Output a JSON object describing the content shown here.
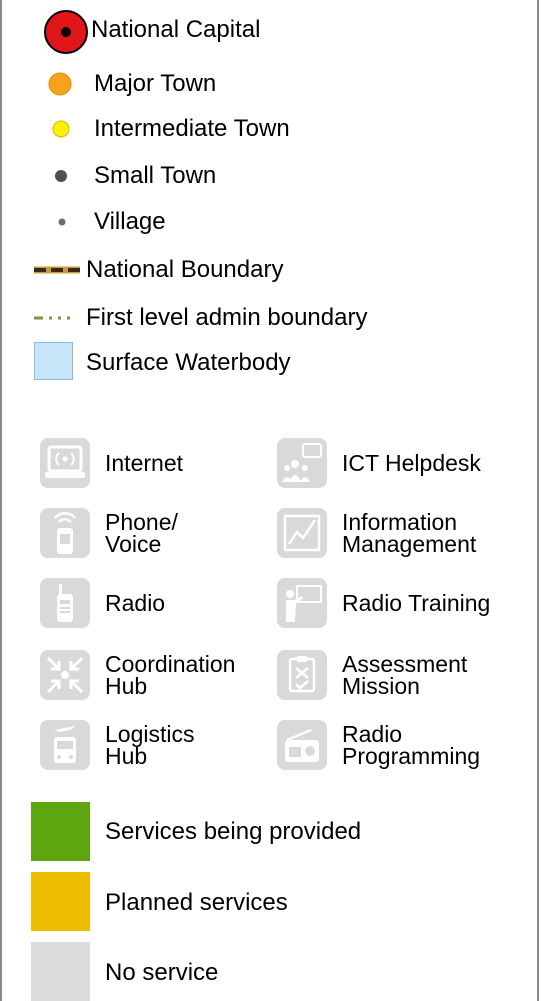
{
  "legend": {
    "settlements": [
      {
        "label": "National Capital"
      },
      {
        "label": "Major Town"
      },
      {
        "label": "Intermediate Town"
      },
      {
        "label": "Small Town"
      },
      {
        "label": "Village"
      }
    ],
    "boundaries": [
      {
        "label": "National Boundary"
      },
      {
        "label": "First level admin boundary"
      }
    ],
    "water": {
      "label": "Surface Waterbody"
    },
    "services": [
      {
        "label": "Internet",
        "icon": "internet-icon"
      },
      {
        "label": "ICT Helpdesk",
        "icon": "ict-helpdesk-icon"
      },
      {
        "label": "Phone/\nVoice",
        "icon": "phone-voice-icon"
      },
      {
        "label": "Information\nManagement",
        "icon": "information-management-icon"
      },
      {
        "label": "Radio",
        "icon": "radio-icon"
      },
      {
        "label": "Radio Training",
        "icon": "radio-training-icon"
      },
      {
        "label": "Coordination\nHub",
        "icon": "coordination-hub-icon"
      },
      {
        "label": "Assessment\nMission",
        "icon": "assessment-mission-icon"
      },
      {
        "label": "Logistics\nHub",
        "icon": "logistics-hub-icon"
      },
      {
        "label": "Radio\nProgramming",
        "icon": "radio-programming-icon"
      }
    ],
    "status": [
      {
        "label": "Services being provided",
        "color": "#5da60f"
      },
      {
        "label": "Planned services",
        "color": "#eebd00"
      },
      {
        "label": "No service",
        "color": "#dcdcdc"
      }
    ]
  },
  "colors": {
    "capital": "#e0161b",
    "major_town": "#f7a21b",
    "intermediate_town": "#ffef00",
    "small_town": "#505050",
    "village": "#6b6b6b",
    "boundary_dark": "#3a2a10",
    "boundary_gold": "#c69a42",
    "admin_boundary": "#8b8a44",
    "water_fill": "#c8e4f8",
    "water_stroke": "#86bde0",
    "service_icon_bg": "#d9d9d9"
  }
}
